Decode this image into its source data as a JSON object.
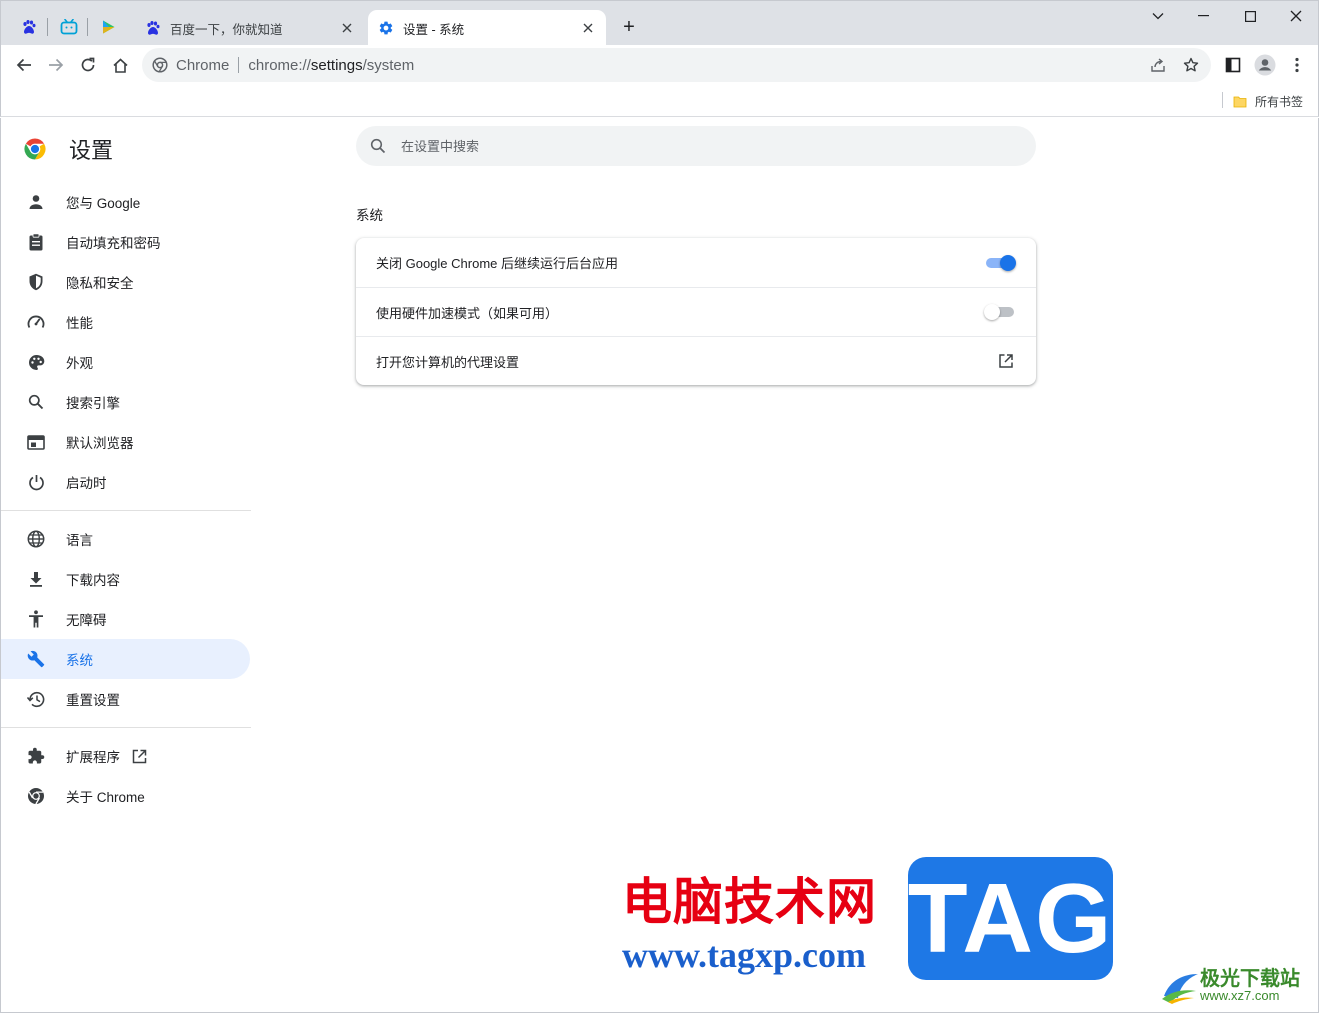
{
  "tabs": {
    "pinned": [
      {
        "name": "baidu-paw-icon"
      },
      {
        "name": "bilibili-tv-icon"
      },
      {
        "name": "play-icon"
      }
    ],
    "inactive": {
      "title": "百度一下，你就知道",
      "icon": "baidu-paw-icon"
    },
    "active": {
      "title": "设置 - 系统",
      "icon": "gear-icon"
    },
    "new_tab_label": "+"
  },
  "toolbar": {
    "site_label": "Chrome",
    "url_scheme": "chrome://",
    "url_host": "settings",
    "url_path": "/system"
  },
  "bookmarks": {
    "all_bookmarks": "所有书签"
  },
  "settings": {
    "title": "设置",
    "search_placeholder": "在设置中搜索",
    "nav": [
      {
        "label": "您与 Google",
        "icon": "person-icon"
      },
      {
        "label": "自动填充和密码",
        "icon": "clipboard-icon"
      },
      {
        "label": "隐私和安全",
        "icon": "shield-icon"
      },
      {
        "label": "性能",
        "icon": "speedometer-icon"
      },
      {
        "label": "外观",
        "icon": "palette-icon"
      },
      {
        "label": "搜索引擎",
        "icon": "search-icon"
      },
      {
        "label": "默认浏览器",
        "icon": "browser-window-icon"
      },
      {
        "label": "启动时",
        "icon": "power-icon"
      },
      {
        "label": "语言",
        "icon": "globe-icon"
      },
      {
        "label": "下载内容",
        "icon": "download-icon"
      },
      {
        "label": "无障碍",
        "icon": "accessibility-icon"
      },
      {
        "label": "系统",
        "icon": "wrench-icon"
      },
      {
        "label": "重置设置",
        "icon": "history-icon"
      },
      {
        "label": "扩展程序",
        "icon": "puzzle-icon"
      },
      {
        "label": "关于 Chrome",
        "icon": "chrome-icon"
      }
    ],
    "selected_nav": "系统",
    "section_title": "系统",
    "rows": [
      {
        "label": "关闭 Google Chrome 后继续运行后台应用",
        "control": "toggle",
        "on": true
      },
      {
        "label": "使用硬件加速模式（如果可用）",
        "control": "toggle",
        "on": false
      },
      {
        "label": "打开您计算机的代理设置",
        "control": "external-link"
      }
    ]
  },
  "colors": {
    "accent": "#1a73e8",
    "nav_selected_bg": "#e8f0fe",
    "tabstrip_bg": "#dee1e6",
    "omnibox_bg": "#f1f3f4"
  },
  "watermark": {
    "site_name": "电脑技术网",
    "site_url": "www.tagxp.com",
    "tag": "TAG",
    "corner_name": "极光下载站",
    "corner_url": "www.xz7.com"
  }
}
